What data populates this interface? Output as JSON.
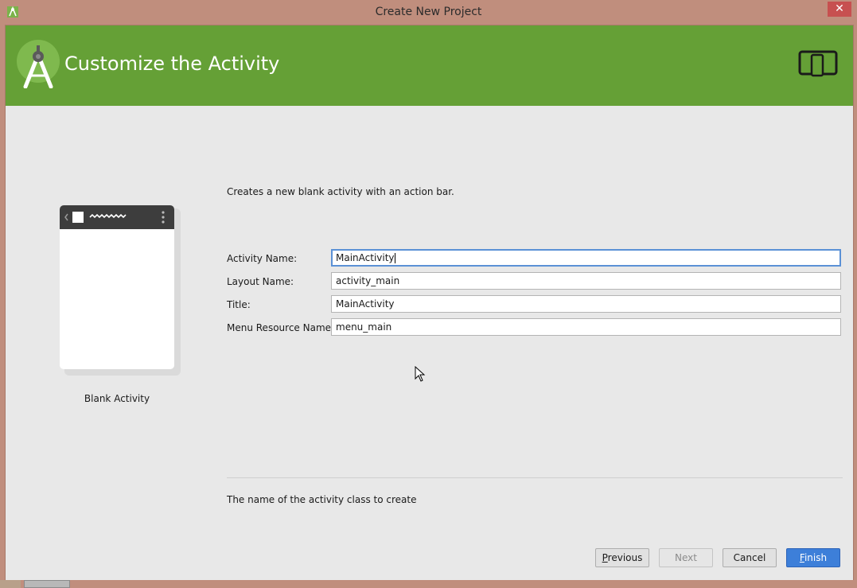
{
  "window": {
    "title": "Create New Project",
    "close_label": "✕"
  },
  "header": {
    "title": "Customize the Activity",
    "accent_color": "#65a036"
  },
  "preview": {
    "label": "Blank Activity"
  },
  "form": {
    "description": "Creates a new blank activity with an action bar.",
    "fields": [
      {
        "label": "Activity Name:",
        "value": "MainActivity"
      },
      {
        "label": "Layout Name:",
        "value": "activity_main"
      },
      {
        "label": "Title:",
        "value": "MainActivity"
      },
      {
        "label": "Menu Resource Name:",
        "value": "menu_main"
      }
    ],
    "help_text": "The name of the activity class to create"
  },
  "buttons": {
    "previous": {
      "mnemonic": "P",
      "rest": "revious"
    },
    "next": "Next",
    "cancel": "Cancel",
    "finish": {
      "mnemonic": "F",
      "rest": "inish"
    }
  },
  "icons": {
    "app": "android-studio-icon",
    "logo": "android-studio-logo-icon",
    "device": "phone-tablet-icon",
    "cursor": "mouse-pointer-icon"
  }
}
